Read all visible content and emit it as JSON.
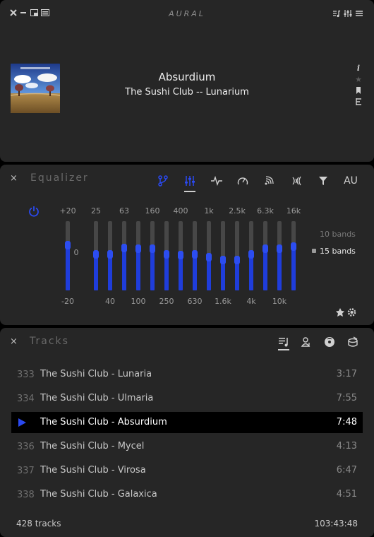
{
  "player": {
    "app_title": "AURAL",
    "title": "Absurdium",
    "artist_album": "The Sushi Club -- Lunarium",
    "window_icons": [
      "close-icon",
      "minimize-icon",
      "mini-player-icon",
      "tab-layout-icon"
    ],
    "header_right_icons": [
      "playlist-icon",
      "equalizer-toggle-icon",
      "menu-icon"
    ],
    "side_icons": [
      "info-icon",
      "star-icon",
      "bookmark-icon",
      "list-icon"
    ]
  },
  "equalizer": {
    "title": "Equalizer",
    "close": "×",
    "tabs": [
      {
        "name": "fork-icon",
        "active": false
      },
      {
        "name": "sliders-icon",
        "active": true
      },
      {
        "name": "waveform-icon",
        "active": false
      },
      {
        "name": "gauge-icon",
        "active": false
      },
      {
        "name": "reverb-icon",
        "active": false
      },
      {
        "name": "delay-icon",
        "active": false
      },
      {
        "name": "filter-icon",
        "active": false
      }
    ],
    "au_label": "AU",
    "top_labels": [
      "+20",
      "25",
      "63",
      "160",
      "400",
      "1k",
      "2.5k",
      "6.3k",
      "16k"
    ],
    "zero_label": "0",
    "bottom_labels": [
      "-20",
      "40",
      "100",
      "250",
      "630",
      "1.6k",
      "4k",
      "10k"
    ],
    "preamp_level": 0.65,
    "band_levels": [
      0.52,
      0.52,
      0.61,
      0.6,
      0.6,
      0.52,
      0.51,
      0.52,
      0.48,
      0.44,
      0.44,
      0.52,
      0.6,
      0.6,
      0.63
    ],
    "band_options": [
      {
        "label": "10 bands",
        "selected": false
      },
      {
        "label": "15 bands",
        "selected": true
      }
    ],
    "bottom_icons": [
      "save-preset-icon",
      "settings-preset-icon"
    ],
    "accent": "#2a49f0"
  },
  "tracks": {
    "title": "Tracks",
    "close": "×",
    "tabs": [
      "tracks-list-icon",
      "artists-icon",
      "albums-icon",
      "genres-icon"
    ],
    "rows": [
      {
        "num": "333",
        "name": "The Sushi Club - Lunaria",
        "duration": "3:17",
        "active": false
      },
      {
        "num": "334",
        "name": "The Sushi Club - Ulmaria",
        "duration": "7:55",
        "active": false
      },
      {
        "num": "",
        "name": "The Sushi Club - Absurdium",
        "duration": "7:48",
        "active": true
      },
      {
        "num": "336",
        "name": "The Sushi Club - Mycel",
        "duration": "4:13",
        "active": false
      },
      {
        "num": "337",
        "name": "The Sushi Club - Virosa",
        "duration": "6:47",
        "active": false
      },
      {
        "num": "338",
        "name": "The Sushi Club - Galaxica",
        "duration": "4:51",
        "active": false
      }
    ],
    "summary_count": "428 tracks",
    "summary_duration": "103:43:48"
  }
}
